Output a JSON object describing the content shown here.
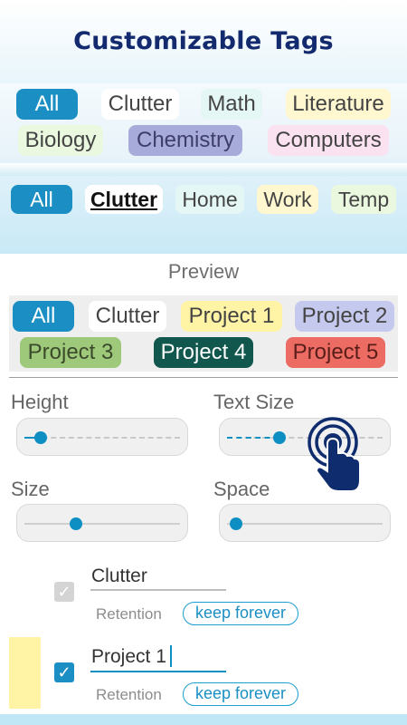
{
  "header": {
    "title": "Customizable Tags"
  },
  "tag_panel": {
    "chips": [
      {
        "label": "All"
      },
      {
        "label": "Clutter"
      },
      {
        "label": "Math"
      },
      {
        "label": "Literature"
      },
      {
        "label": "Biology"
      },
      {
        "label": "Chemistry"
      },
      {
        "label": "Computers"
      }
    ]
  },
  "tab_bar": {
    "tabs": [
      {
        "label": "All"
      },
      {
        "label": "Clutter"
      },
      {
        "label": "Home"
      },
      {
        "label": "Work"
      },
      {
        "label": "Temp"
      }
    ]
  },
  "preview": {
    "label": "Preview",
    "chips": [
      {
        "label": "All"
      },
      {
        "label": "Clutter"
      },
      {
        "label": "Project 1"
      },
      {
        "label": "Project 2"
      },
      {
        "label": "Project 3"
      },
      {
        "label": "Project 4"
      },
      {
        "label": "Project 5"
      }
    ]
  },
  "controls": {
    "height": {
      "label": "Height",
      "value_fraction": 0.1
    },
    "text_size": {
      "label": "Text Size",
      "value_fraction": 0.33
    },
    "size": {
      "label": "Size",
      "value_fraction": 0.35
    },
    "space": {
      "label": "Space",
      "value_fraction": 0.0
    }
  },
  "tag_list": [
    {
      "name": "Clutter",
      "checked": true,
      "enabled": false,
      "retention_label": "Retention",
      "retention_value": "keep forever"
    },
    {
      "name": "Project 1",
      "checked": true,
      "enabled": true,
      "retention_label": "Retention",
      "retention_value": "keep forever"
    }
  ],
  "colors": {
    "accent": "#0d8fc4",
    "title": "#132a6e",
    "project1_swatch": "#fff3a6"
  },
  "icons": {
    "gesture": "tap-hand-icon",
    "check": "check-icon"
  }
}
